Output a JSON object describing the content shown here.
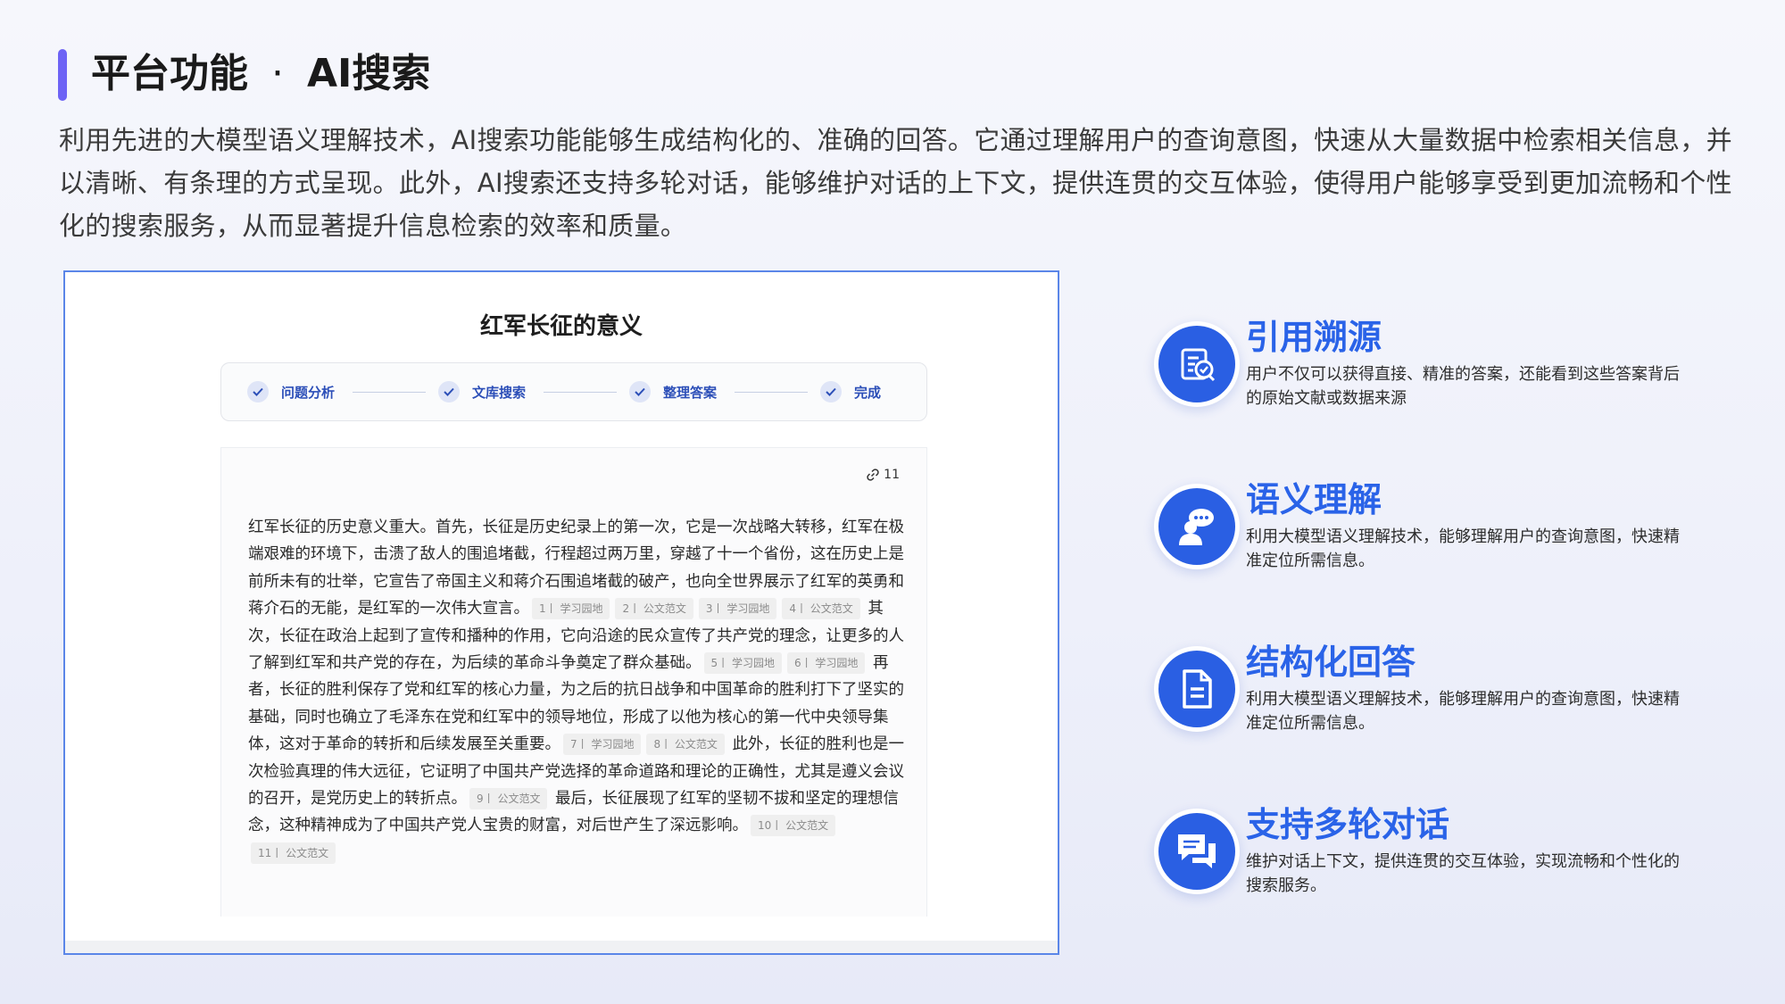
{
  "header": {
    "title_main": "平台功能",
    "title_sep": "·",
    "title_sub": "AI搜索",
    "intro": "利用先进的大模型语义理解技术，AI搜索功能能够生成结构化的、准确的回答。它通过理解用户的查询意图，快速从大量数据中检索相关信息，并以清晰、有条理的方式呈现。此外，AI搜索还支持多轮对话，能够维护对话的上下文，提供连贯的交互体验，使得用户能够享受到更加流畅和个性化的搜索服务，从而显著提升信息检索的效率和质量。"
  },
  "screenshot": {
    "title": "红军长征的意义",
    "steps": [
      "问题分析",
      "文库搜索",
      "整理答案",
      "完成"
    ],
    "reference_count": "11",
    "paragraph": [
      {
        "t": "text",
        "v": "红军长征的历史意义重大。首先，长征是历史纪录上的第一次，它是一次战略大转移，红军在极端艰难的环境下，击溃了敌人的围追堵截，行程超过两万里，穿越了十一个省份，这在历史上是前所未有的壮举，它宣告了帝国主义和蒋介石围追堵截的破产，也向全世界展示了红军的英勇和蒋介石的无能，是红军的一次伟大宣言。"
      },
      {
        "t": "cite",
        "v": "1丨 学习园地"
      },
      {
        "t": "cite",
        "v": "2丨 公文范文"
      },
      {
        "t": "cite",
        "v": "3丨 学习园地"
      },
      {
        "t": "cite",
        "v": "4丨 公文范文"
      },
      {
        "t": "text",
        "v": " 其次，长征在政治上起到了宣传和播种的作用，它向沿途的民众宣传了共产党的理念，让更多的人了解到红军和共产党的存在，为后续的革命斗争奠定了群众基础。"
      },
      {
        "t": "cite",
        "v": "5丨 学习园地"
      },
      {
        "t": "cite",
        "v": "6丨 学习园地"
      },
      {
        "t": "text",
        "v": " 再者，长征的胜利保存了党和红军的核心力量，为之后的抗日战争和中国革命的胜利打下了坚实的基础，同时也确立了毛泽东在党和红军中的领导地位，形成了以他为核心的第一代中央领导集体，这对于革命的转折和后续发展至关重要。"
      },
      {
        "t": "cite",
        "v": "7丨 学习园地"
      },
      {
        "t": "cite",
        "v": "8丨 公文范文"
      },
      {
        "t": "text",
        "v": " 此外，长征的胜利也是一次检验真理的伟大远征，它证明了中国共产党选择的革命道路和理论的正确性，尤其是遵义会议的召开，是党历史上的转折点。"
      },
      {
        "t": "cite",
        "v": "9丨 公文范文"
      },
      {
        "t": "text",
        "v": " 最后，长征展现了红军的坚韧不拔和坚定的理想信念，这种精神成为了中国共产党人宝贵的财富，对后世产生了深远影响。"
      },
      {
        "t": "cite",
        "v": "10丨 公文范文"
      },
      {
        "t": "cite",
        "v": "11丨 公文范文"
      }
    ]
  },
  "features": [
    {
      "icon": "document-check-icon",
      "title": "引用溯源",
      "desc": "用户不仅可以获得直接、精准的答案，还能看到这些答案背后的原始文献或数据来源"
    },
    {
      "icon": "brain-user-icon",
      "title": "语义理解",
      "desc": "利用大模型语义理解技术，能够理解用户的查询意图，快速精准定位所需信息。"
    },
    {
      "icon": "document-icon",
      "title": "结构化回答",
      "desc": "利用大模型语义理解技术，能够理解用户的查询意图，快速精准定位所需信息。"
    },
    {
      "icon": "chat-bubbles-icon",
      "title": "支持多轮对话",
      "desc": "维护对话上下文，提供连贯的交互体验，实现流畅和个性化的搜索服务。"
    }
  ],
  "colors": {
    "accent_bar": "#6d63f5",
    "feature_blue": "#2a63e8",
    "icon_bg": "#2a5fe3",
    "step_text": "#2c4fb8"
  }
}
